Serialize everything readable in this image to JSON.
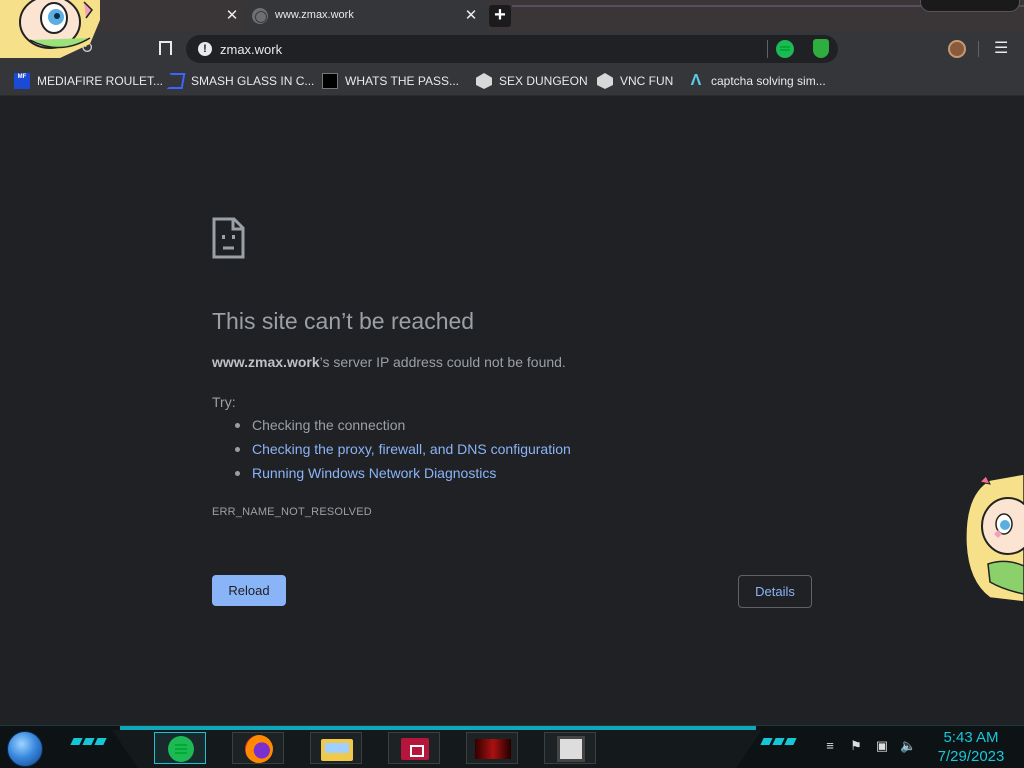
{
  "tabs": [
    {
      "title": "",
      "close": "✕"
    },
    {
      "title": "www.zmax.work",
      "close": "✕"
    }
  ],
  "new_tab_label": "+",
  "toolbar": {
    "reload_glyph": "↻",
    "url": "zmax.work",
    "info_glyph": "!",
    "menu_glyph": "☰"
  },
  "bookmarks": [
    {
      "label": "MEDIAFIRE ROULET...",
      "icon": "mediafire-icon"
    },
    {
      "label": "SMASH GLASS IN C...",
      "icon": "smash-icon"
    },
    {
      "label": "WHATS THE PASS...",
      "icon": "black-square-icon"
    },
    {
      "label": "SEX DUNGEON",
      "icon": "dungeon-icon"
    },
    {
      "label": "VNC FUN",
      "icon": "dungeon-icon"
    },
    {
      "label": "captcha solving sim...",
      "icon": "lambda-icon"
    }
  ],
  "error": {
    "title": "This site can’t be reached",
    "host": "www.zmax.work",
    "message_suffix": "’s server IP address could not be found.",
    "try_label": "Try:",
    "suggestions": [
      "Checking the connection",
      "Checking the proxy, firewall, and DNS configuration",
      "Running Windows Network Diagnostics"
    ],
    "code": "ERR_NAME_NOT_RESOLVED",
    "reload_label": "Reload",
    "details_label": "Details"
  },
  "taskbar": {
    "time": "5:43 AM",
    "date": "7/29/2023",
    "apps": [
      "spotify-icon",
      "firefox-icon",
      "file-explorer-icon",
      "red-app-icon",
      "game-icon",
      "pixel-app-icon"
    ]
  },
  "colors": {
    "page_bg": "#202124",
    "link": "#8ab4f8",
    "text": "#9aa0a6",
    "accent_teal": "#18c7da"
  }
}
